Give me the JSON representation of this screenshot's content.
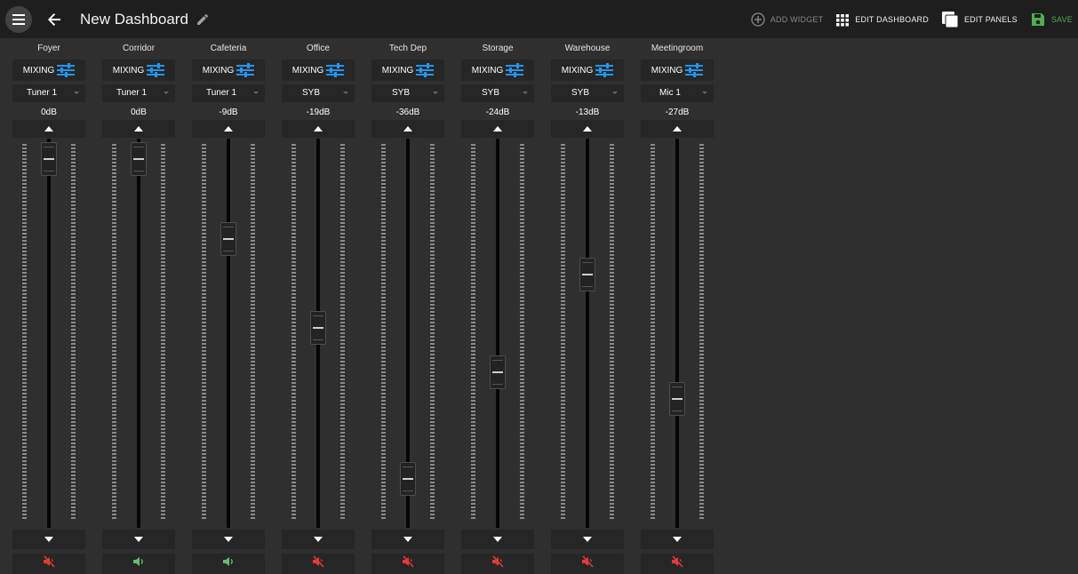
{
  "header": {
    "title": "New Dashboard",
    "actions": {
      "add_widget": "ADD WIDGET",
      "edit_dashboard": "EDIT DASHBOARD",
      "edit_panels": "EDIT PANELS",
      "save": "SAVE"
    }
  },
  "colors": {
    "mixing_icon": "#2196f3",
    "muted": "#e53935",
    "unmuted": "#66bb6a",
    "save": "#4caf50"
  },
  "strips": [
    {
      "name": "Foyer",
      "mode": "MIXING",
      "source": "Tuner 1",
      "level": "0dB",
      "level_db": 0,
      "muted": true
    },
    {
      "name": "Corridor",
      "mode": "MIXING",
      "source": "Tuner 1",
      "level": "0dB",
      "level_db": 0,
      "muted": false
    },
    {
      "name": "Cafeteria",
      "mode": "MIXING",
      "source": "Tuner 1",
      "level": "-9dB",
      "level_db": -9,
      "muted": false
    },
    {
      "name": "Office",
      "mode": "MIXING",
      "source": "SYB",
      "level": "-19dB",
      "level_db": -19,
      "muted": true
    },
    {
      "name": "Tech Dep",
      "mode": "MIXING",
      "source": "SYB",
      "level": "-36dB",
      "level_db": -36,
      "muted": true
    },
    {
      "name": "Storage",
      "mode": "MIXING",
      "source": "SYB",
      "level": "-24dB",
      "level_db": -24,
      "muted": true
    },
    {
      "name": "Warehouse",
      "mode": "MIXING",
      "source": "SYB",
      "level": "-13dB",
      "level_db": -13,
      "muted": true
    },
    {
      "name": "Meetingroom",
      "mode": "MIXING",
      "source": "Mic 1",
      "level": "-27dB",
      "level_db": -27,
      "muted": true
    }
  ]
}
